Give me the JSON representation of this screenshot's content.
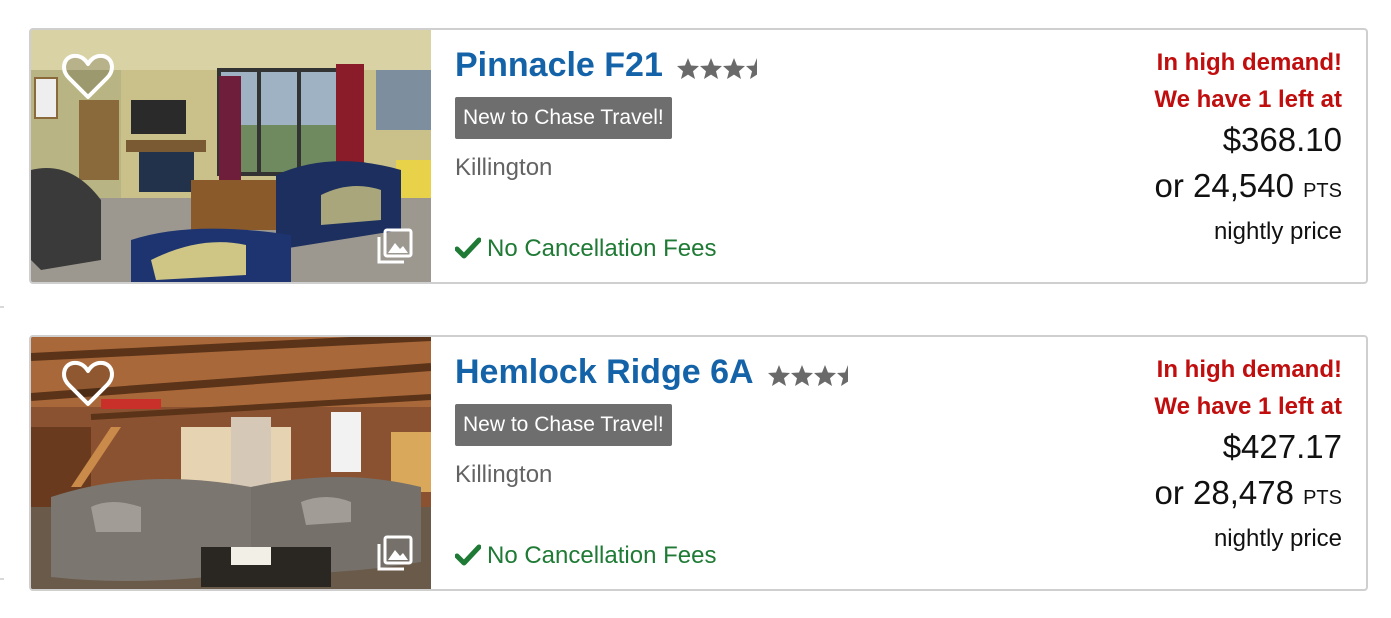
{
  "listings": [
    {
      "name": "Pinnacle F21",
      "rating": 3.5,
      "badge": "New to Chase Travel!",
      "location": "Killington",
      "cancellation": "No Cancellation Fees",
      "demand_line1": "In high demand!",
      "demand_line2": "We have 1 left at",
      "price": "$368.10",
      "points_prefix": "or ",
      "points": "24,540",
      "points_unit": "PTS",
      "price_note": "nightly price"
    },
    {
      "name": "Hemlock Ridge 6A",
      "rating": 3.5,
      "badge": "New to Chase Travel!",
      "location": "Killington",
      "cancellation": "No Cancellation Fees",
      "demand_line1": "In high demand!",
      "demand_line2": "We have 1 left at",
      "price": "$427.17",
      "points_prefix": "or ",
      "points": "28,478",
      "points_unit": "PTS",
      "price_note": "nightly price"
    }
  ],
  "colors": {
    "title": "#1463a8",
    "demand": "#c00d0d",
    "cancellation": "#1e7a34",
    "badge_bg": "#6e6e6e",
    "star": "#6a6a6a"
  },
  "icons": {
    "favorite": "heart-outline-icon",
    "gallery": "photo-gallery-icon",
    "cancellation": "checkmark-icon",
    "rating": "star-icon"
  }
}
